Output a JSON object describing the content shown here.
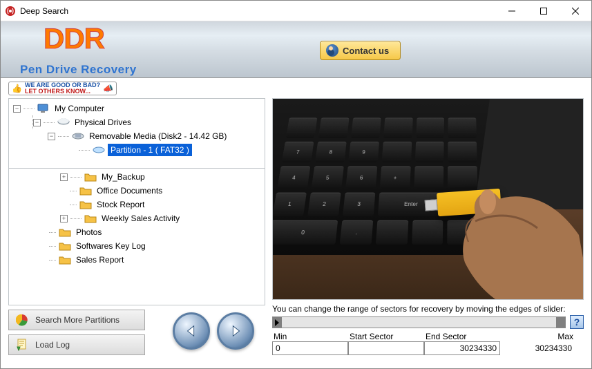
{
  "window": {
    "title": "Deep Search"
  },
  "header": {
    "logo": "DDR",
    "subtitle": "Pen Drive Recovery",
    "contact": "Contact us"
  },
  "feedback": {
    "line1": "WE ARE GOOD OR BAD?",
    "line2": "LET OTHERS KNOW..."
  },
  "tree": {
    "root": "My Computer",
    "drives": "Physical Drives",
    "removable": "Removable Media (Disk2 - 14.42 GB)",
    "partition": "Partition - 1 ( FAT32 )"
  },
  "folders": [
    "My_Backup",
    "Office Documents",
    "Stock Report",
    "Weekly Sales Activity",
    "Photos",
    "Softwares Key Log",
    "Sales Report"
  ],
  "buttons": {
    "searchMore": "Search More Partitions",
    "loadLog": "Load Log"
  },
  "slider": {
    "hint": "You can change the range of sectors for recovery by moving the edges of slider:",
    "minLabel": "Min",
    "startLabel": "Start Sector",
    "endLabel": "End Sector",
    "maxLabel": "Max",
    "min": "0",
    "start": "",
    "end": "30234330",
    "max": "30234330"
  },
  "help": "?"
}
